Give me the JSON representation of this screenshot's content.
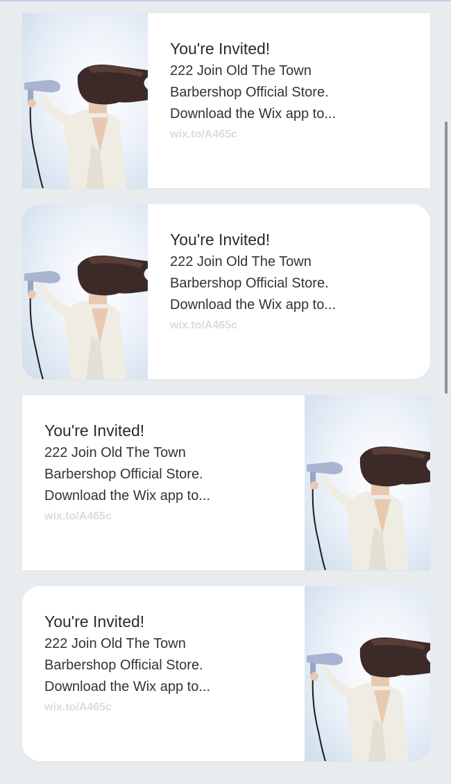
{
  "cards": [
    {
      "title": "You're Invited!",
      "lines": [
        "222 Join Old The Town",
        "Barbershop Official Store.",
        "Download the Wix app to..."
      ],
      "link": "wix.to/A465c",
      "image_position": "left",
      "shape": "square"
    },
    {
      "title": "You're Invited!",
      "lines": [
        "222 Join Old The Town",
        "Barbershop Official Store.",
        "Download the Wix app to..."
      ],
      "link": "wix.to/A465c",
      "image_position": "left",
      "shape": "rounded"
    },
    {
      "title": "You're Invited!",
      "lines": [
        "222 Join Old The Town",
        "Barbershop Official Store.",
        "Download the Wix app to..."
      ],
      "link": "wix.to/A465c",
      "image_position": "right",
      "shape": "square"
    },
    {
      "title": "You're Invited!",
      "lines": [
        "222 Join Old The Town",
        "Barbershop Official Store.",
        "Download the Wix app to..."
      ],
      "link": "wix.to/A465c",
      "image_position": "right",
      "shape": "rounded"
    }
  ],
  "colors": {
    "background": "#e8ecef",
    "card": "#ffffff",
    "title_text": "#262a33",
    "link_text": "#d9dbde"
  },
  "icons": [
    "hair-dryer-woman-photo"
  ]
}
